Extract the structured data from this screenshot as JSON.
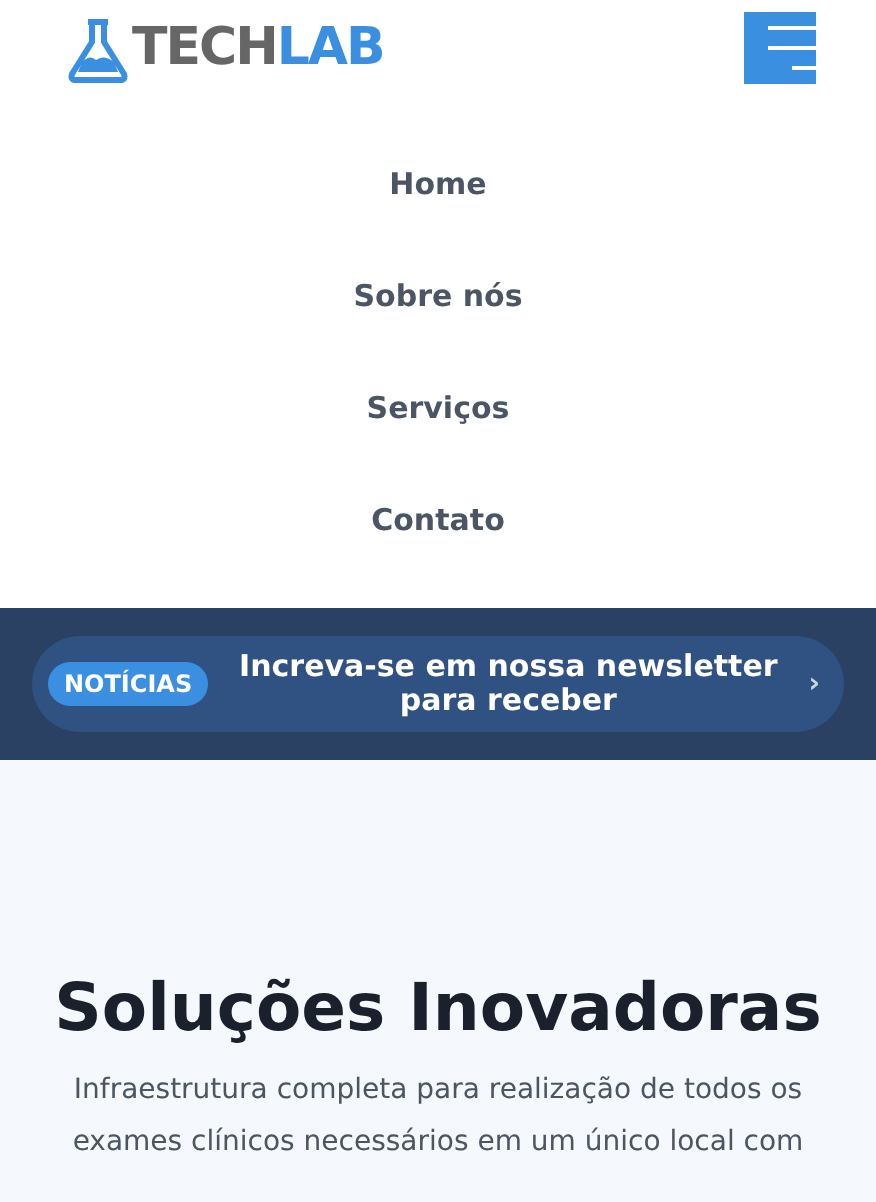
{
  "logo": {
    "part_1": "TECH",
    "part_2": "LAB"
  },
  "nav": {
    "items": [
      {
        "label": "Home"
      },
      {
        "label": "Sobre nós"
      },
      {
        "label": "Serviços"
      },
      {
        "label": "Contato"
      }
    ]
  },
  "announcement": {
    "badge": "NOTÍCIAS",
    "text": "Increva-se em nossa newsletter para receber",
    "arrow": "›"
  },
  "hero": {
    "title": "Soluções Inovadoras",
    "description": "Infraestrutura completa para realização de todos os exames clínicos necessários em um único local com"
  }
}
